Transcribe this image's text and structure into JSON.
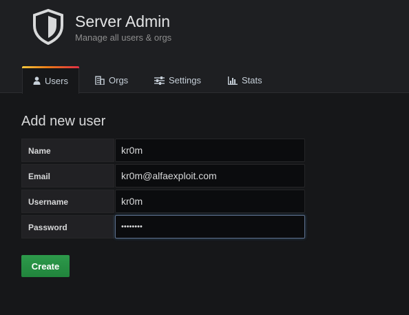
{
  "header": {
    "title": "Server Admin",
    "subtitle": "Manage all users & orgs",
    "logo_icon": "shield-icon"
  },
  "tabs": [
    {
      "label": "Users",
      "icon": "user-icon",
      "active": true
    },
    {
      "label": "Orgs",
      "icon": "building-icon",
      "active": false
    },
    {
      "label": "Settings",
      "icon": "sliders-icon",
      "active": false
    },
    {
      "label": "Stats",
      "icon": "bar-chart-icon",
      "active": false
    }
  ],
  "form": {
    "heading": "Add new user",
    "fields": [
      {
        "label": "Name",
        "value": "kr0m",
        "type": "text"
      },
      {
        "label": "Email",
        "value": "kr0m@alfaexploit.com",
        "type": "text"
      },
      {
        "label": "Username",
        "value": "kr0m",
        "type": "text"
      },
      {
        "label": "Password",
        "value": "••••••••",
        "type": "password",
        "focused": true
      }
    ],
    "submit_label": "Create"
  },
  "colors": {
    "accent_gradient": [
      "#f4c63d",
      "#eb7b18",
      "#e02f44"
    ],
    "button_green": "#299c46",
    "background": "#161719"
  }
}
